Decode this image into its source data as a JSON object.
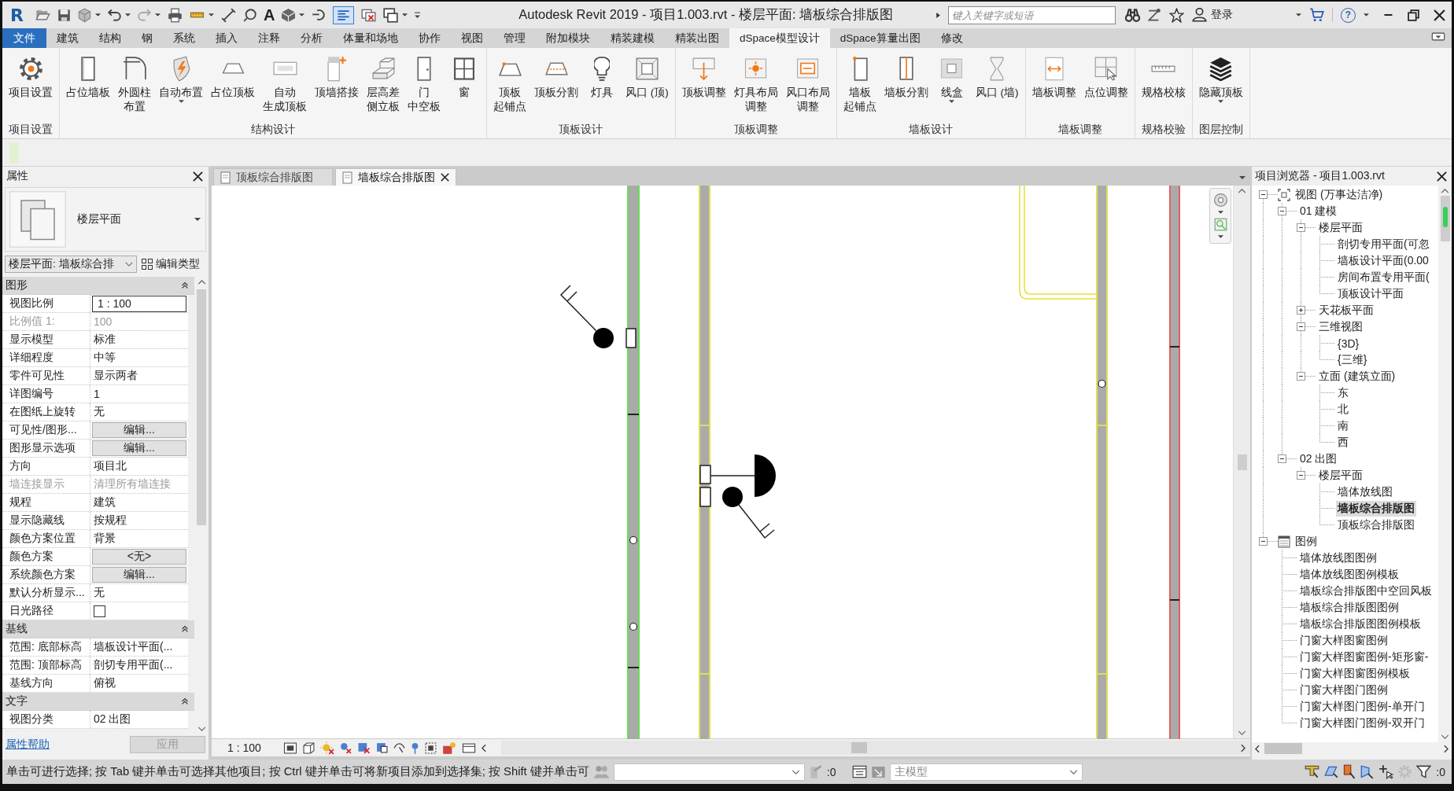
{
  "window": {
    "logo": "R",
    "text_tool": "A",
    "toolbar_toggle_on": true,
    "title": "Autodesk Revit 2019 - 项目1.003.rvt - 楼层平面: 墙板综合排版图",
    "search": {
      "placeholder": "键入关键字或短语"
    },
    "sign_in": "登录",
    "help": "?"
  },
  "menu_tabs": [
    {
      "label": "文件",
      "kind": "app",
      "selected": false
    },
    {
      "label": "建筑",
      "kind": "tab",
      "selected": false
    },
    {
      "label": "结构",
      "kind": "tab",
      "selected": false
    },
    {
      "label": "钢",
      "kind": "tab",
      "selected": false
    },
    {
      "label": "系统",
      "kind": "tab",
      "selected": false
    },
    {
      "label": "插入",
      "kind": "tab",
      "selected": false
    },
    {
      "label": "注释",
      "kind": "tab",
      "selected": false
    },
    {
      "label": "分析",
      "kind": "tab",
      "selected": false
    },
    {
      "label": "体量和场地",
      "kind": "tab",
      "selected": false
    },
    {
      "label": "协作",
      "kind": "tab",
      "selected": false
    },
    {
      "label": "视图",
      "kind": "tab",
      "selected": false
    },
    {
      "label": "管理",
      "kind": "tab",
      "selected": false
    },
    {
      "label": "附加模块",
      "kind": "tab",
      "selected": false
    },
    {
      "label": "精装建模",
      "kind": "tab",
      "selected": false
    },
    {
      "label": "精装出图",
      "kind": "tab",
      "selected": false
    },
    {
      "label": "dSpace模型设计",
      "kind": "tab",
      "selected": true
    },
    {
      "label": "dSpace算量出图",
      "kind": "tab",
      "selected": false
    },
    {
      "label": "修改",
      "kind": "tab",
      "selected": false
    }
  ],
  "ribbon": {
    "panels": [
      {
        "title": "项目设置",
        "buttons": [
          {
            "lines": [
              "项目设置"
            ],
            "dropdown": false
          }
        ]
      },
      {
        "title": "结构设计",
        "buttons": [
          {
            "lines": [
              "占位墙板"
            ],
            "dropdown": false
          },
          {
            "lines": [
              "外圆柱",
              "布置"
            ],
            "dropdown": false
          },
          {
            "lines": [
              "自动布置"
            ],
            "dropdown": true
          },
          {
            "lines": [
              "占位顶板"
            ],
            "dropdown": false
          },
          {
            "lines": [
              "自动",
              "生成顶板"
            ],
            "dropdown": false
          },
          {
            "lines": [
              "顶墙搭接"
            ],
            "dropdown": false
          },
          {
            "lines": [
              "层高差",
              "侧立板"
            ],
            "dropdown": false
          },
          {
            "lines": [
              "门",
              "中空板"
            ],
            "dropdown": false
          },
          {
            "lines": [
              "窗"
            ],
            "dropdown": false
          }
        ]
      },
      {
        "title": "顶板设计",
        "buttons": [
          {
            "lines": [
              "顶板",
              "起铺点"
            ],
            "dropdown": false
          },
          {
            "lines": [
              "顶板分割"
            ],
            "dropdown": false
          },
          {
            "lines": [
              "灯具"
            ],
            "dropdown": false
          },
          {
            "lines": [
              "风口 (顶)"
            ],
            "dropdown": false
          }
        ]
      },
      {
        "title": "顶板调整",
        "buttons": [
          {
            "lines": [
              "顶板调整"
            ],
            "dropdown": false
          },
          {
            "lines": [
              "灯具布局",
              "调整"
            ],
            "dropdown": false
          },
          {
            "lines": [
              "风口布局",
              "调整"
            ],
            "dropdown": false
          }
        ]
      },
      {
        "title": "墙板设计",
        "buttons": [
          {
            "lines": [
              "墙板",
              "起铺点"
            ],
            "dropdown": false
          },
          {
            "lines": [
              "墙板分割"
            ],
            "dropdown": false
          },
          {
            "lines": [
              "线盒"
            ],
            "dropdown": true
          },
          {
            "lines": [
              "风口 (墙)"
            ],
            "dropdown": false
          }
        ]
      },
      {
        "title": "墙板调整",
        "buttons": [
          {
            "lines": [
              "墙板调整"
            ],
            "dropdown": false
          },
          {
            "lines": [
              "点位调整"
            ],
            "dropdown": false
          }
        ]
      },
      {
        "title": "规格校验",
        "buttons": [
          {
            "lines": [
              "规格校核"
            ],
            "dropdown": false
          }
        ]
      },
      {
        "title": "图层控制",
        "buttons": [
          {
            "lines": [
              "隐藏顶板"
            ],
            "dropdown": true
          }
        ]
      }
    ]
  },
  "properties": {
    "title": "属性",
    "type_name": "楼层平面",
    "instance": "楼层平面: 墙板综合排",
    "edit_type": "编辑类型",
    "groups": [
      {
        "title": "图形",
        "rows": [
          {
            "name": "视图比例",
            "value": "1 : 100",
            "kind": "input",
            "disabled": false
          },
          {
            "name": "比例值 1:",
            "value": "100",
            "kind": "text",
            "disabled": true
          },
          {
            "name": "显示模型",
            "value": "标准",
            "kind": "text",
            "disabled": false
          },
          {
            "name": "详细程度",
            "value": "中等",
            "kind": "text",
            "disabled": false
          },
          {
            "name": "零件可见性",
            "value": "显示两者",
            "kind": "text",
            "disabled": false
          },
          {
            "name": "详图编号",
            "value": "1",
            "kind": "text",
            "disabled": false
          },
          {
            "name": "在图纸上旋转",
            "value": "无",
            "kind": "text",
            "disabled": false
          },
          {
            "name": "可见性/图形...",
            "value": "编辑...",
            "kind": "button",
            "disabled": false
          },
          {
            "name": "图形显示选项",
            "value": "编辑...",
            "kind": "button",
            "disabled": false
          },
          {
            "name": "方向",
            "value": "项目北",
            "kind": "text",
            "disabled": false
          },
          {
            "name": "墙连接显示",
            "value": "清理所有墙连接",
            "kind": "text",
            "disabled": true
          },
          {
            "name": "规程",
            "value": "建筑",
            "kind": "text",
            "disabled": false
          },
          {
            "name": "显示隐藏线",
            "value": "按规程",
            "kind": "text",
            "disabled": false
          },
          {
            "name": "颜色方案位置",
            "value": "背景",
            "kind": "text",
            "disabled": false
          },
          {
            "name": "颜色方案",
            "value": "<无>",
            "kind": "button",
            "disabled": false
          },
          {
            "name": "系统颜色方案",
            "value": "编辑...",
            "kind": "button",
            "disabled": false
          },
          {
            "name": "默认分析显示...",
            "value": "无",
            "kind": "text",
            "disabled": false
          },
          {
            "name": "日光路径",
            "kind": "checkbox",
            "checked": false,
            "disabled": false
          }
        ]
      },
      {
        "title": "基线",
        "rows": [
          {
            "name": "范围: 底部标高",
            "value": "墙板设计平面(...",
            "kind": "text",
            "disabled": false
          },
          {
            "name": "范围: 顶部标高",
            "value": "剖切专用平面(...",
            "kind": "text",
            "disabled": false
          },
          {
            "name": "基线方向",
            "value": "俯视",
            "kind": "text",
            "disabled": false
          }
        ]
      },
      {
        "title": "文字",
        "rows": [
          {
            "name": "视图分类",
            "value": "02 出图",
            "kind": "text",
            "disabled": false
          }
        ]
      }
    ],
    "help": "属性帮助",
    "apply": {
      "label": "应用",
      "disabled": true
    }
  },
  "view_tabs": [
    {
      "label": "顶板综合排版图",
      "selected": false
    },
    {
      "label": "墙板综合排版图",
      "selected": true
    }
  ],
  "canvas": {
    "walls": [
      {
        "color": "#66dd55"
      },
      {
        "color": "#e2dc55"
      },
      {
        "color": "#e2dc55"
      },
      {
        "color": "#e26060"
      }
    ]
  },
  "view_bar": {
    "scale": "1 : 100"
  },
  "browser": {
    "title": "项目浏览器 - 项目1.003.rvt",
    "tree": [
      {
        "label": "视图 (万事达洁净)",
        "expanded": true,
        "selected": false,
        "children": [
          {
            "label": "01 建模",
            "expanded": true,
            "selected": false,
            "children": [
              {
                "label": "楼层平面",
                "expanded": true,
                "selected": false,
                "children": [
                  {
                    "label": "剖切专用平面(可忽",
                    "selected": false
                  },
                  {
                    "label": "墙板设计平面(0.00",
                    "selected": false
                  },
                  {
                    "label": "房间布置专用平面(",
                    "selected": false
                  },
                  {
                    "label": "顶板设计平面",
                    "selected": false
                  }
                ]
              },
              {
                "label": "天花板平面",
                "expanded": false,
                "selected": false
              },
              {
                "label": "三维视图",
                "expanded": true,
                "selected": false,
                "children": [
                  {
                    "label": "{3D}",
                    "selected": false
                  },
                  {
                    "label": "{三维}",
                    "selected": false
                  }
                ]
              },
              {
                "label": "立面 (建筑立面)",
                "expanded": true,
                "selected": false,
                "children": [
                  {
                    "label": "东",
                    "selected": false
                  },
                  {
                    "label": "北",
                    "selected": false
                  },
                  {
                    "label": "南",
                    "selected": false
                  },
                  {
                    "label": "西",
                    "selected": false
                  }
                ]
              }
            ]
          },
          {
            "label": "02 出图",
            "expanded": true,
            "selected": false,
            "children": [
              {
                "label": "楼层平面",
                "expanded": true,
                "selected": false,
                "children": [
                  {
                    "label": "墙体放线图",
                    "selected": false
                  },
                  {
                    "label": "墙板综合排版图",
                    "selected": true
                  },
                  {
                    "label": "顶板综合排版图",
                    "selected": false
                  }
                ]
              }
            ]
          }
        ]
      },
      {
        "label": "图例",
        "expanded": true,
        "selected": false,
        "children": [
          {
            "label": "墙体放线图图例",
            "selected": false
          },
          {
            "label": "墙体放线图图例模板",
            "selected": false
          },
          {
            "label": "墙板综合排版图中空回风板",
            "selected": false
          },
          {
            "label": "墙板综合排版图图例",
            "selected": false
          },
          {
            "label": "墙板综合排版图图例模板",
            "selected": false
          },
          {
            "label": "门窗大样图窗图例",
            "selected": false
          },
          {
            "label": "门窗大样图窗图例-矩形窗-",
            "selected": false
          },
          {
            "label": "门窗大样图窗图例模板",
            "selected": false
          },
          {
            "label": "门窗大样图门图例",
            "selected": false
          },
          {
            "label": "门窗大样图门图例-单开门",
            "selected": false
          },
          {
            "label": "门窗大样图门图例-双开门",
            "selected": false
          }
        ]
      }
    ]
  },
  "status_bar": {
    "hint": "单击可进行选择; 按 Tab 键并单击可选择其他项目; 按 Ctrl 键并单击可将新项目添加到选择集; 按 Shift 键并单击可",
    "count": ":0",
    "model": "主模型",
    "filter_count": ":0"
  }
}
